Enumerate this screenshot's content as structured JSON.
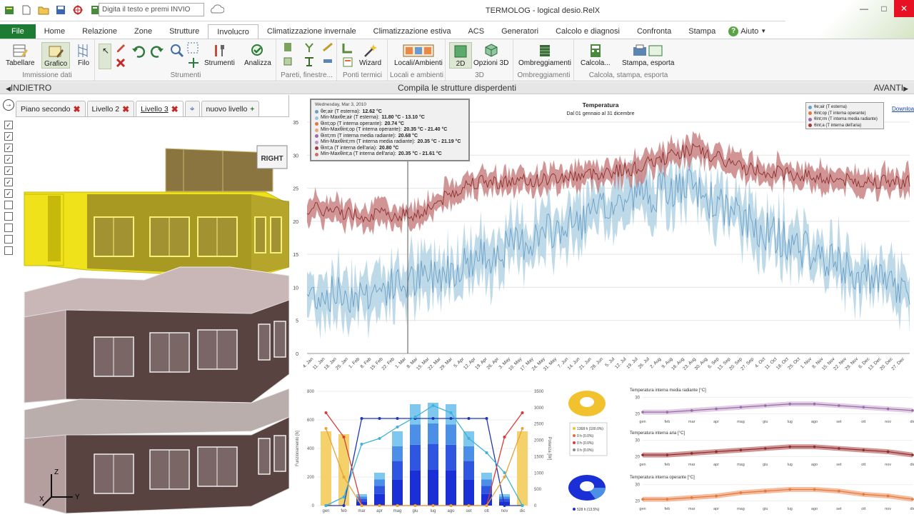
{
  "window": {
    "title": "TERMOLOG - logical desio.RelX",
    "search_placeholder": "Digita il testo e premi INVIO"
  },
  "menu_tabs": [
    "File",
    "Home",
    "Relazione",
    "Zone",
    "Strutture",
    "Involucro",
    "Climatizzazione invernale",
    "Climatizzazione estiva",
    "ACS",
    "Generatori",
    "Calcolo e diagnosi",
    "Confronta",
    "Stampa",
    "Aiuto"
  ],
  "ribbon": {
    "g1": {
      "b1": "Tabellare",
      "b2": "Grafico",
      "b3": "Filo",
      "label": "Immissione dati"
    },
    "g2": {
      "b1": "Strumenti",
      "b2": "Analizza",
      "label": "Strumenti"
    },
    "g3": {
      "label": "Pareti, finestre..."
    },
    "g4": {
      "b1": "Wizard",
      "label": "Ponti termici"
    },
    "g5": {
      "b1": "Locali/Ambienti",
      "label": "Locali e ambienti"
    },
    "g6": {
      "b1": "2D",
      "b2": "Opzioni 3D",
      "label": "3D"
    },
    "g7": {
      "b1": "Ombreggiamenti",
      "label": "Ombreggiamenti"
    },
    "g8": {
      "b1": "Calcola...",
      "b2": "Stampa, esporta",
      "label": "Calcola, stampa, esporta"
    }
  },
  "nav": {
    "back": "INDIETRO",
    "center": "Compila le strutture disperdenti",
    "forward": "AVANTI"
  },
  "levels": [
    "Piano secondo",
    "Livello 2",
    "Livello 3",
    "nuovo livello"
  ],
  "viewcube": "RIGHT",
  "axes3d": {
    "z": "Z",
    "x": "X",
    "y": "Y"
  },
  "checkboxes": [
    true,
    true,
    true,
    true,
    true,
    true,
    true,
    false,
    false,
    false,
    false,
    false
  ],
  "main_chart": {
    "title": "Temperatura",
    "subtitle": "Dal 01 gennaio al 31 dicembre",
    "download": "Download",
    "y_ticks": [
      "35",
      "30",
      "25",
      "20",
      "15",
      "10",
      "5",
      "0"
    ],
    "x_ticks": [
      "4. Jan",
      "11. Jan",
      "18. Jan",
      "25. Jan",
      "1. Feb",
      "8. Feb",
      "15. Feb",
      "22. Feb",
      "1. Mar",
      "8. Mar",
      "15. Mar",
      "22. Mar",
      "29. Mar",
      "5. Apr",
      "12. Apr",
      "19. Apr",
      "26. Apr",
      "3. May",
      "10. May",
      "17. May",
      "24. May",
      "31. May",
      "7. Jun",
      "14. Jun",
      "21. Jun",
      "28. Jun",
      "5. Jul",
      "12. Jul",
      "19. Jul",
      "26. Jul",
      "2. Aug",
      "9. Aug",
      "16. Aug",
      "23. Aug",
      "30. Aug",
      "6. Sep",
      "13. Sep",
      "20. Sep",
      "27. Sep",
      "4. Oct",
      "11. Oct",
      "18. Oct",
      "25. Oct",
      "1. Nov",
      "8. Nov",
      "15. Nov",
      "22. Nov",
      "29. Nov",
      "6. Dec",
      "13. Dec",
      "20. Dec",
      "27. Dec"
    ],
    "legend": [
      "θe;air (T esterna)",
      "θint;op (T interna operante)",
      "θint;rm (T interna media radiante)",
      "θint;a (T interna dell'aria)"
    ],
    "tooltip": {
      "date": "Wednesday, Mar 3, 2010",
      "rows": [
        {
          "label": "θe;air (T esterna): ",
          "value": "12.62 °C",
          "color": "#6b9fc7"
        },
        {
          "label": "Min-Maxθe;air (T esterna): ",
          "value": "11.80 °C - 13.10 °C",
          "color": "#9cc3dd"
        },
        {
          "label": "θint;op (T interna operante): ",
          "value": "20.74 °C",
          "color": "#e1783f"
        },
        {
          "label": "Min-Maxθint;op (T interna operante): ",
          "value": "20.35 °C - 21.40 °C",
          "color": "#e9a47a"
        },
        {
          "label": "θint;rm (T interna media radiante): ",
          "value": "20.68 °C",
          "color": "#9b6aa8"
        },
        {
          "label": "Min-Maxθint;rm (T interna media radiante): ",
          "value": "20.35 °C - 21.19 °C",
          "color": "#bb97c4"
        },
        {
          "label": "θint;a (T interna dell'aria): ",
          "value": "20.80 °C",
          "color": "#a13a3a"
        },
        {
          "label": "Min-Maxθint;a (T interna dell'aria): ",
          "value": "20.35 °C - 21.61 °C",
          "color": "#c97070"
        }
      ]
    }
  },
  "chart_data": [
    {
      "type": "line",
      "title": "Temperatura",
      "ylim": [
        0,
        35
      ],
      "x": [
        "Jan",
        "Feb",
        "Mar",
        "Apr",
        "May",
        "Jun",
        "Jul",
        "Aug",
        "Sep",
        "Oct",
        "Nov",
        "Dec"
      ],
      "series": [
        {
          "name": "θe;air (T esterna)",
          "values": [
            9,
            9,
            11,
            14,
            17,
            20,
            24,
            25,
            20,
            16,
            12,
            9
          ]
        },
        {
          "name": "θint;a (T interna dell'aria)",
          "values": [
            22,
            21,
            21,
            26,
            26,
            27,
            28,
            31,
            28,
            27,
            26,
            26
          ]
        }
      ]
    },
    {
      "type": "bar",
      "categories": [
        "gen",
        "feb",
        "mar",
        "apr",
        "mag",
        "giu",
        "lug",
        "ago",
        "set",
        "ott",
        "nov",
        "dic"
      ],
      "y_ticks": [
        "800",
        "600",
        "400",
        "200",
        "0"
      ],
      "y2_ticks": [
        "3500",
        "3000",
        "2500",
        "2000",
        "1500",
        "1000",
        "500",
        "0"
      ],
      "ylabel": "Funzionamento [h]",
      "y2label": "Potenza [W]",
      "values": [
        0,
        0,
        80,
        230,
        520,
        710,
        720,
        710,
        520,
        230,
        80,
        0
      ]
    },
    {
      "type": "line",
      "title": "Temperatura interna media radiante [°C]",
      "categories": [
        "gen",
        "feb",
        "mar",
        "apr",
        "mag",
        "giu",
        "lug",
        "ago",
        "set",
        "ott",
        "nov",
        "dic"
      ],
      "values": [
        21,
        21,
        22,
        23,
        24,
        25,
        26,
        26,
        25,
        24,
        23,
        22
      ]
    },
    {
      "type": "line",
      "title": "Temperatura interna aria [°C]",
      "categories": [
        "gen",
        "feb",
        "mar",
        "apr",
        "mag",
        "giu",
        "lug",
        "ago",
        "set",
        "ott",
        "nov",
        "dic"
      ],
      "values": [
        21,
        21,
        22,
        23,
        24,
        25,
        26,
        26,
        25,
        24,
        23,
        21
      ]
    },
    {
      "type": "line",
      "title": "Temperatura interna operante [°C]",
      "categories": [
        "gen",
        "feb",
        "mar",
        "apr",
        "mag",
        "giu",
        "lug",
        "ago",
        "set",
        "ott",
        "nov",
        "dic"
      ],
      "values": [
        21,
        21,
        22,
        23,
        25,
        26,
        27,
        27,
        26,
        24,
        23,
        21
      ]
    }
  ],
  "mini": {
    "months": [
      "gen",
      "feb",
      "mar",
      "apr",
      "mag",
      "giu",
      "lug",
      "ago",
      "set",
      "ott",
      "nov",
      "dic"
    ],
    "mr_title": "Temperatura interna media radiante [°C]",
    "aria_title": "Temperatura interna aria [°C]",
    "op_title": "Temperatura interna operante [°C]",
    "mr_ticks": [
      "30",
      "20"
    ],
    "aria_ticks": [
      "30",
      "20"
    ],
    "op_ticks": [
      "30",
      "20"
    ],
    "pie1_legend": [
      "1368 h (100.0%)",
      "0 h (0.0%)",
      "0 h (0.0%)",
      "0 h (0.0%)"
    ],
    "pie2_legend": [
      "528 h (13.5%)"
    ]
  },
  "colors": {
    "accent": "#1e7b34",
    "ext_band": "#a8cde0",
    "int_band": "#c98282",
    "building_yellow": "#efe11a",
    "building_brown": "#5a4542"
  }
}
